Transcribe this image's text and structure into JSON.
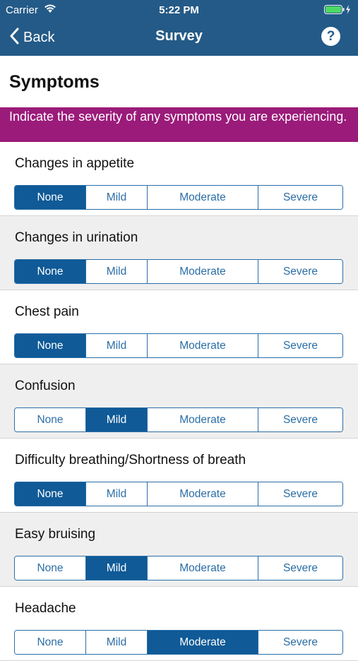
{
  "status": {
    "carrier": "Carrier",
    "time": "5:22 PM"
  },
  "nav": {
    "back_label": "Back",
    "title": "Survey",
    "help_label": "?"
  },
  "section": {
    "title": "Symptoms"
  },
  "banner": {
    "text": "Indicate the severity of any symptoms you are experiencing."
  },
  "options": [
    "None",
    "Mild",
    "Moderate",
    "Severe"
  ],
  "questions": [
    {
      "label": "Changes in appetite",
      "selected": "None"
    },
    {
      "label": "Changes in urination",
      "selected": "None"
    },
    {
      "label": "Chest pain",
      "selected": "None"
    },
    {
      "label": "Confusion",
      "selected": "Mild"
    },
    {
      "label": "Difficulty breathing/Shortness of breath",
      "selected": "None"
    },
    {
      "label": "Easy bruising",
      "selected": "Mild"
    },
    {
      "label": "Headache",
      "selected": "Moderate"
    }
  ],
  "colors": {
    "header": "#245a87",
    "banner": "#9b1b7a",
    "selected": "#0f5a97",
    "accent": "#2b6ea6"
  },
  "icons": {
    "wifi": "wifi-icon",
    "battery": "battery-icon",
    "charging": "bolt-icon",
    "back": "chevron-left-icon",
    "help": "question-circle-icon"
  }
}
